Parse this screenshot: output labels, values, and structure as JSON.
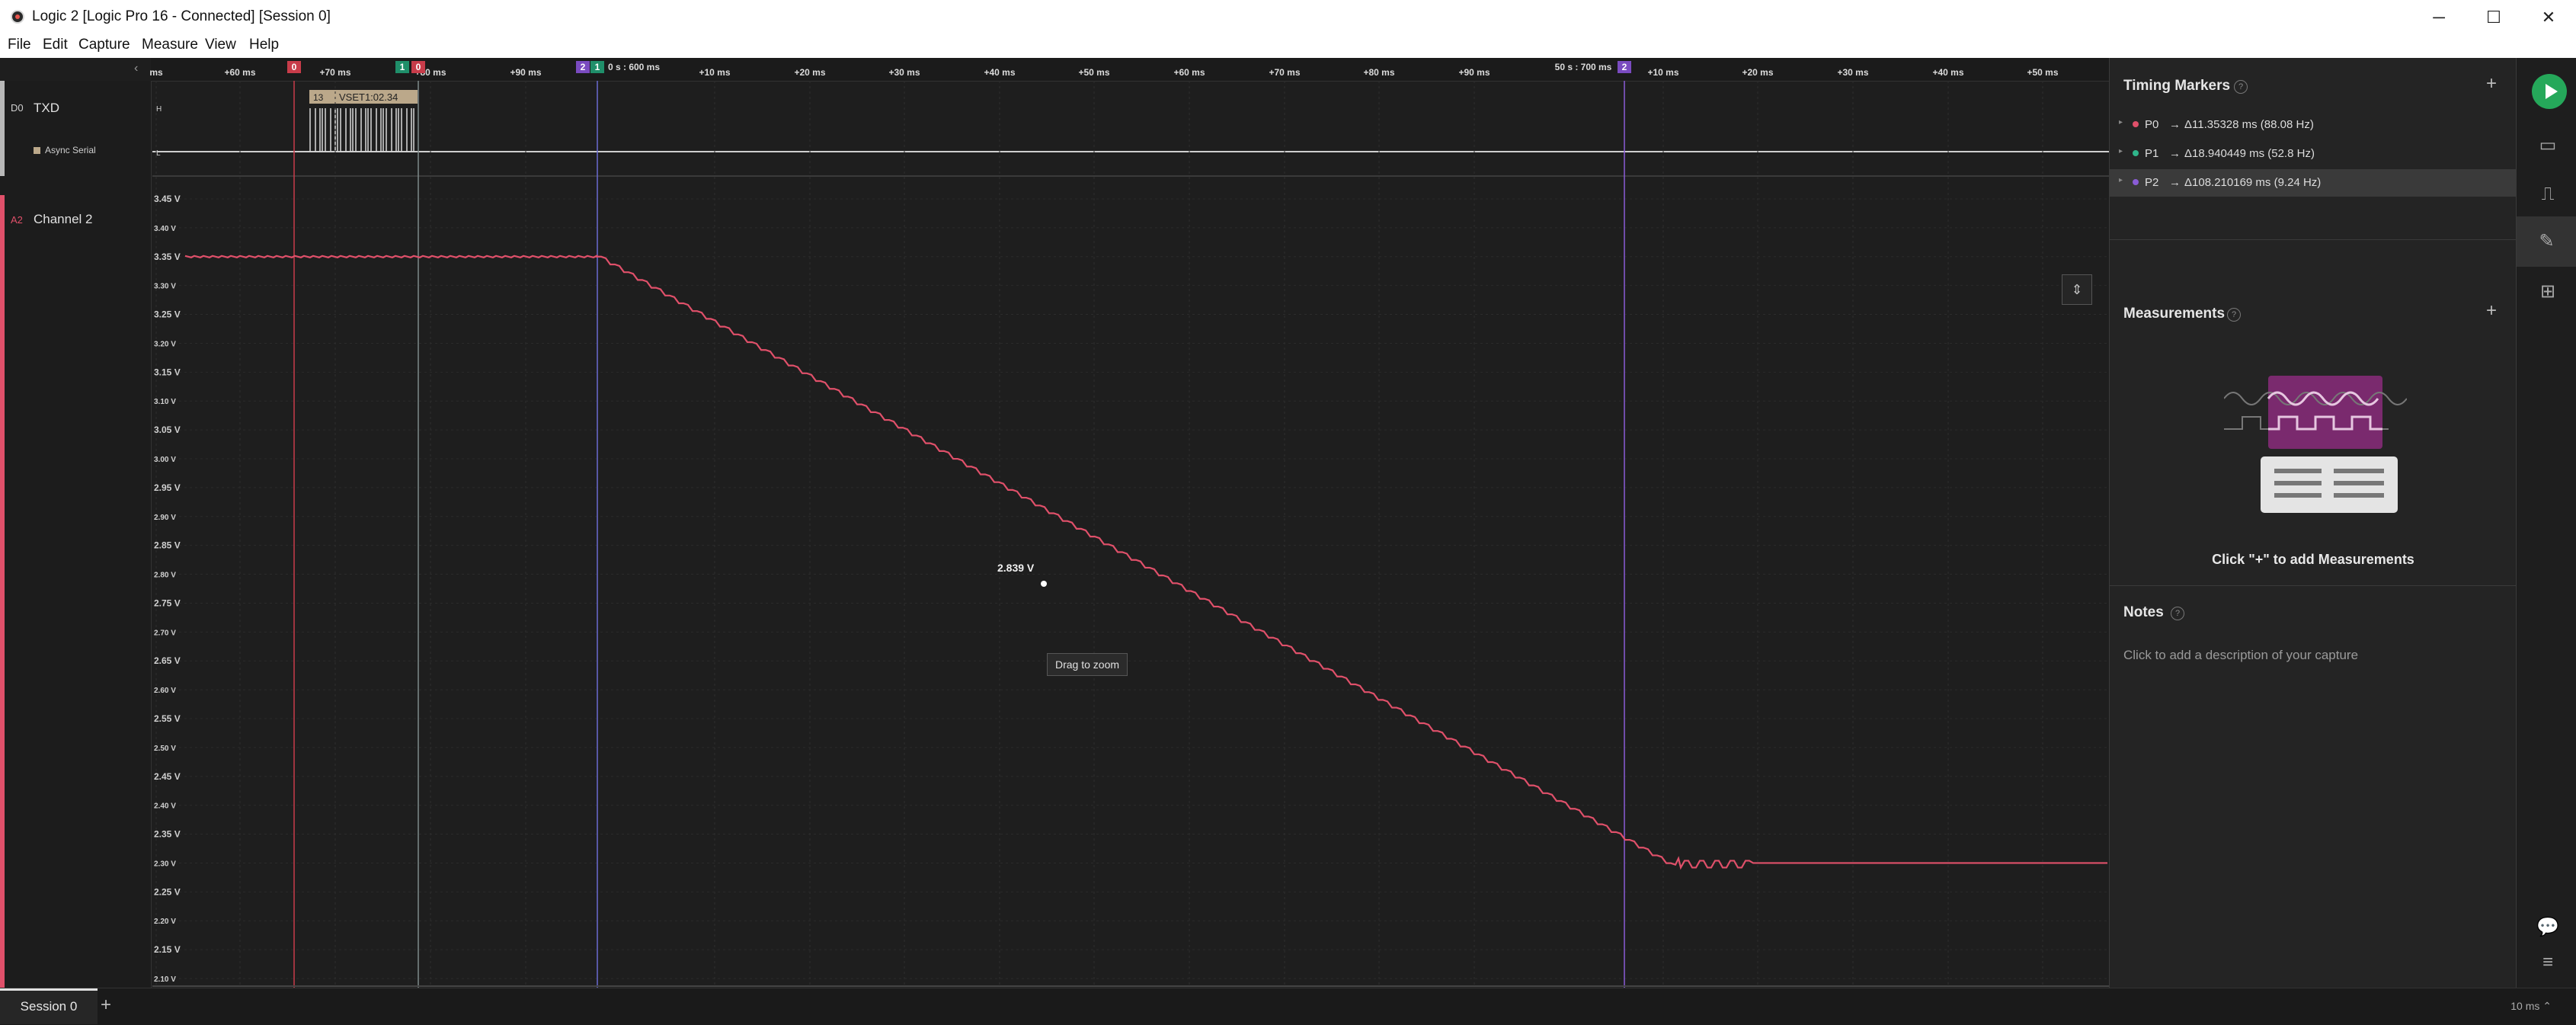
{
  "window": {
    "title": "Logic 2 [Logic Pro 16 - Connected] [Session 0]",
    "minimize": "─",
    "maximize": "☐",
    "close": "✕"
  },
  "menu": [
    "File",
    "Edit",
    "Capture",
    "Measure",
    "View",
    "Help"
  ],
  "ruler": {
    "major_labels": [
      {
        "text": "0 s : 600 ms"
      },
      {
        "text": "50 s : 700 ms"
      }
    ],
    "tick_labels": [
      "ms",
      "+60 ms",
      "+70 ms",
      "+80 ms",
      "+90 ms",
      "+10 ms",
      "+20 ms",
      "+30 ms",
      "+40 ms",
      "+50 ms",
      "+60 ms",
      "+70 ms",
      "+80 ms",
      "+90 ms",
      "+10 ms",
      "+20 ms",
      "+30 ms",
      "+40 ms",
      "+50 ms"
    ],
    "collapse_icon": "‹"
  },
  "timing_marker_flags": [
    {
      "label": "0",
      "color": "#c83c4a"
    },
    {
      "label": "1",
      "color": "#1f8f6a"
    },
    {
      "label": "0",
      "color": "#c83c4a"
    },
    {
      "label": "2",
      "color": "#7a4bc0"
    },
    {
      "label": "1",
      "color": "#1f8f6a"
    },
    {
      "label": "2",
      "color": "#7a4bc0"
    }
  ],
  "channels": [
    {
      "id": "D0",
      "name": "TXD",
      "analyzer": "Async Serial",
      "color": "#b8b8b8",
      "hi": "H",
      "lo": "L"
    },
    {
      "id": "A2",
      "name": "Channel 2",
      "color": "#e0506a"
    }
  ],
  "serial_decode": {
    "index": "13",
    "text": "VSET1:02.34"
  },
  "analog_axis": {
    "labels": [
      "3.45 V",
      "3.40 V",
      "3.35 V",
      "3.30 V",
      "3.25 V",
      "3.20 V",
      "3.15 V",
      "3.10 V",
      "3.05 V",
      "3.00 V",
      "2.95 V",
      "2.90 V",
      "2.85 V",
      "2.80 V",
      "2.75 V",
      "2.70 V",
      "2.65 V",
      "2.60 V",
      "2.55 V",
      "2.50 V",
      "2.45 V",
      "2.40 V",
      "2.35 V",
      "2.30 V",
      "2.25 V",
      "2.20 V",
      "2.15 V",
      "2.10 V"
    ],
    "max_v": 3.45,
    "min_v": 2.1
  },
  "trace": {
    "high_v": 3.35,
    "low_v": 2.29,
    "settle_v": 2.3
  },
  "cursor_value": "2.839 V",
  "zoom_hint": "Drag to zoom",
  "fit_icon": "⇕",
  "sidebar": {
    "timing_markers_title": "Timing Markers",
    "help": "?",
    "add": "+",
    "markers": [
      {
        "id": "P0",
        "arrow": "→",
        "text": "Δ11.35328 ms (88.08 Hz)",
        "color": "#e0506a"
      },
      {
        "id": "P1",
        "arrow": "→",
        "text": "Δ18.940449 ms (52.8 Hz)",
        "color": "#2fb58a"
      },
      {
        "id": "P2",
        "arrow": "→",
        "text": "Δ108.210169 ms (9.24 Hz)",
        "color": "#8a5cd6"
      }
    ],
    "measurements_title": "Measurements",
    "measurements_hint": "Click \"+\" to add Measurements",
    "notes_title": "Notes",
    "notes_hint": "Click to add a description of your capture"
  },
  "rail_icons": [
    "play-icon",
    "device-icon",
    "analyzer-icon",
    "ruler-icon",
    "extensions-icon",
    "chat-icon",
    "menu-icon"
  ],
  "rail_glyphs": {
    "device": "▭",
    "analyzer": "⎍",
    "ruler": "✎",
    "extensions": "⊞",
    "chat": "💬",
    "menu": "≡"
  },
  "status": {
    "session_tab": "Session 0",
    "new_session": "+",
    "zoom_level": "10 ms ⌃"
  }
}
